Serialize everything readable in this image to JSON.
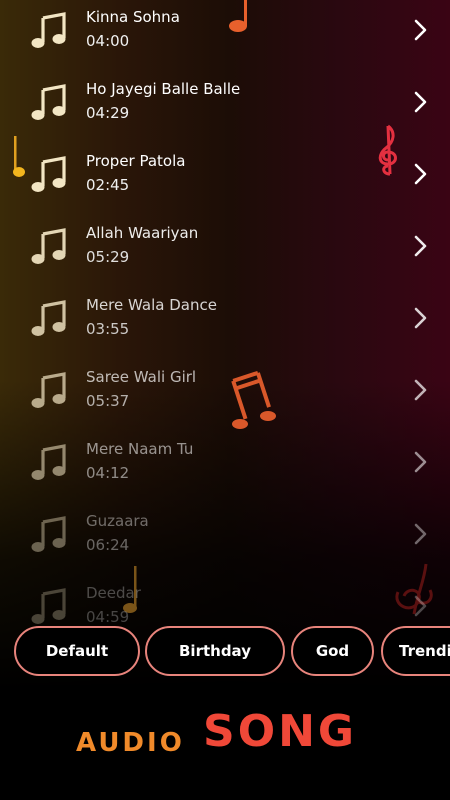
{
  "songs": [
    {
      "title": "Kinna Sohna",
      "duration": "04:00"
    },
    {
      "title": "Ho Jayegi Balle Balle",
      "duration": "04:29"
    },
    {
      "title": "Proper Patola",
      "duration": "02:45"
    },
    {
      "title": "Allah Waariyan",
      "duration": "05:29"
    },
    {
      "title": "Mere Wala Dance",
      "duration": "03:55"
    },
    {
      "title": "Saree Wali Girl",
      "duration": "05:37"
    },
    {
      "title": "Mere Naam Tu",
      "duration": "04:12"
    },
    {
      "title": "Guzaara",
      "duration": "06:24"
    },
    {
      "title": "Deedar",
      "duration": "04:59"
    }
  ],
  "categories": [
    "Default",
    "Birthday",
    "God",
    "Trending"
  ],
  "logo": {
    "word1": "AUDIO",
    "word2": "SONG"
  },
  "icons": {
    "song": "music-note-icon",
    "row_action": "chevron-right-icon"
  },
  "colors": {
    "chip_border": "#e8847c",
    "logo_audio": "#f08a2a",
    "logo_song": "#f04838"
  }
}
